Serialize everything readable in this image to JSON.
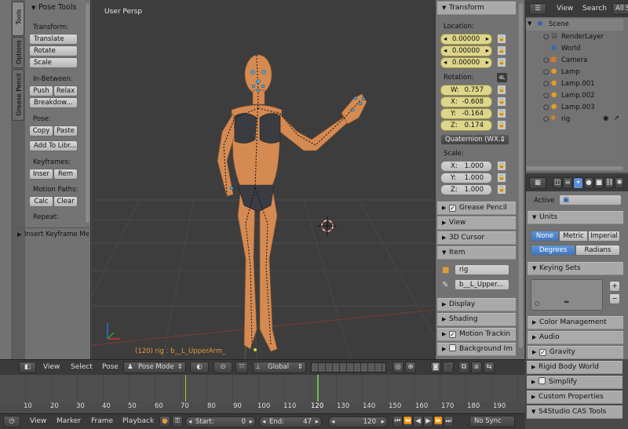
{
  "toolshelf": {
    "tabs": [
      "Tools",
      "Options",
      "Grease Pencil"
    ],
    "header": "Pose Tools",
    "transform_label": "Transform:",
    "translate": "Translate",
    "rotate": "Rotate",
    "scale": "Scale",
    "inbetween_label": "In-Between:",
    "push": "Push",
    "relax": "Relax",
    "breakdown": "Breakdow...",
    "pose_label": "Pose:",
    "copy": "Copy",
    "paste": "Paste",
    "add_to_library": "Add To Libr...",
    "keyframes_label": "Keyframes:",
    "insert": "Inser",
    "remove": "Rem",
    "motion_paths_label": "Motion Paths:",
    "calc": "Calc",
    "clear": "Clear",
    "repeat_label": "Repeat:",
    "insert_keyframe_menu": "Insert Keyframe Me"
  },
  "viewport": {
    "view_name": "User Persp",
    "status": "(120) rig : b__L_UpperArm_"
  },
  "properties_n": {
    "transform_header": "Transform",
    "location_label": "Location:",
    "location": [
      "0.00000",
      "0.00000",
      "0.00000"
    ],
    "rotation_label": "Rotation:",
    "rotation_mode_tag": "4L",
    "rotation": [
      {
        "axis": "W:",
        "value": "0.757"
      },
      {
        "axis": "X:",
        "value": "-0.608"
      },
      {
        "axis": "Y:",
        "value": "-0.164"
      },
      {
        "axis": "Z:",
        "value": "0.174"
      }
    ],
    "rotation_mode": "Quaternion (WX...",
    "scale_label": "Scale:",
    "scale": [
      {
        "axis": "X:",
        "value": "1.000"
      },
      {
        "axis": "Y:",
        "value": "1.000"
      },
      {
        "axis": "Z:",
        "value": "1.000"
      }
    ],
    "grease_pencil": "Grease Pencil",
    "view": "View",
    "cursor_3d": "3D Cursor",
    "item": "Item",
    "item_object": "rig",
    "item_bone": "b__L_Upper...",
    "display": "Display",
    "shading": "Shading",
    "motion_tracking": "Motion Trackin",
    "background_images": "Background Im"
  },
  "outliner": {
    "view": "View",
    "search": "Search",
    "filter": "All S",
    "scene": "Scene",
    "items": [
      {
        "name": "RenderLayer",
        "indent": 1
      },
      {
        "name": "World",
        "indent": 1
      },
      {
        "name": "Camera",
        "indent": 1
      },
      {
        "name": "Lamp",
        "indent": 1
      },
      {
        "name": "Lamp.001",
        "indent": 1
      },
      {
        "name": "Lamp.002",
        "indent": 1
      },
      {
        "name": "Lamp.003",
        "indent": 1
      },
      {
        "name": "rig",
        "indent": 1
      }
    ]
  },
  "scene_props": {
    "active_label": "Active",
    "units_header": "Units",
    "unit_none": "None",
    "unit_metric": "Metric",
    "unit_imperial": "Imperial",
    "degrees": "Degrees",
    "radians": "Radians",
    "keying_sets_header": "Keying Sets",
    "color_management": "Color Management",
    "audio": "Audio",
    "gravity": "Gravity",
    "rigid_body_world": "Rigid Body World",
    "simplify": "Simplify",
    "custom_properties": "Custom Properties",
    "s4studio": "S4Studio CAS Tools"
  },
  "view3d_header": {
    "view": "View",
    "select": "Select",
    "pose": "Pose",
    "mode": "Pose Mode",
    "orientation": "Global"
  },
  "timeline": {
    "ticks": [
      "10",
      "20",
      "30",
      "40",
      "50",
      "60",
      "70",
      "80",
      "90",
      "100",
      "110",
      "120",
      "130",
      "140",
      "150",
      "160",
      "170",
      "180",
      "190"
    ],
    "view": "View",
    "marker": "Marker",
    "frame": "Frame",
    "playback": "Playback",
    "start_label": "Start:",
    "start": "0",
    "end_label": "End:",
    "end": "47",
    "current": "120",
    "sync": "No Sync"
  },
  "colors": {
    "accent": "#5b8fd6",
    "keyframe": "#c8c83a",
    "viewport_bg": "#3d3d3d",
    "location_field": "#ddd68c"
  }
}
